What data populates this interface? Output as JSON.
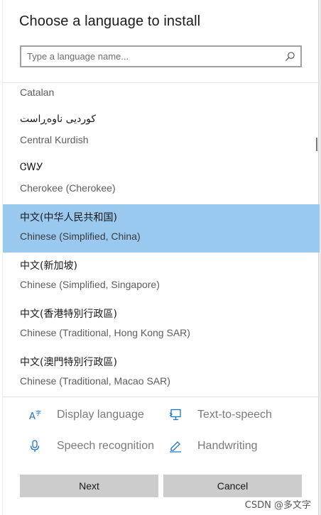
{
  "dialog": {
    "title": "Choose a language to install",
    "search_placeholder": "Type a language name..."
  },
  "languages": [
    {
      "english": "Catalan",
      "partial": true
    },
    {
      "native": "کوردیی ناوەڕاست",
      "english": "Central Kurdish"
    },
    {
      "native": "ᏣᎳᎩ",
      "english": "Cherokee (Cherokee)"
    },
    {
      "native": "中文(中华人民共和国)",
      "english": "Chinese (Simplified, China)",
      "selected": true
    },
    {
      "native": "中文(新加坡)",
      "english": "Chinese (Simplified, Singapore)"
    },
    {
      "native": "中文(香港特別行政區)",
      "english": "Chinese (Traditional, Hong Kong SAR)"
    },
    {
      "native": "中文(澳門特別行政區)",
      "english": "Chinese (Traditional, Macao SAR)"
    }
  ],
  "features": {
    "display_language": "Display language",
    "text_to_speech": "Text-to-speech",
    "speech_recognition": "Speech recognition",
    "handwriting": "Handwriting"
  },
  "buttons": {
    "next": "Next",
    "cancel": "Cancel"
  },
  "watermark": "CSDN @多文字",
  "colors": {
    "selected_row": "#99c9ef",
    "button": "#cccccc",
    "feature_icon": "#1a73c8"
  }
}
